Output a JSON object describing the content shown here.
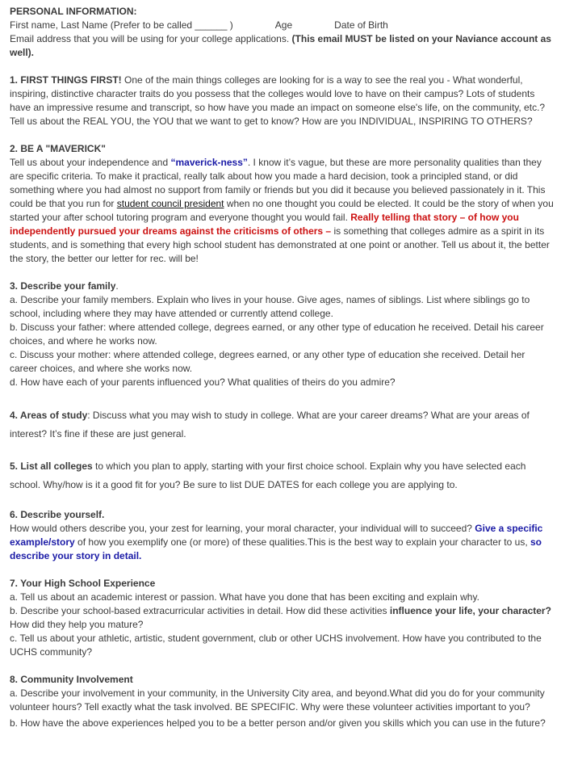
{
  "personal": {
    "heading": "PERSONAL INFORMATION:",
    "name_fields": "First name,  Last Name (Prefer to be called ______ )",
    "age": "Age",
    "dob": "Date of Birth",
    "email_text": "Email address that you will be using for your college applications.  ",
    "email_bold": "(This email MUST be listed on your Naviance account as well)."
  },
  "s1": {
    "heading": "1.  FIRST THINGS FIRST!",
    "body": " One of the main things colleges are looking for is a way to see the real you - What wonderful, inspiring, distinctive character traits do you possess that the colleges would love to have on their campus?  Lots of students have an impressive resume and transcript, so how have you made an impact on someone else's life, on the community, etc.?  Tell us about the REAL YOU, the YOU that we want to get to know?  How are you INDIVIDUAL, INSPIRING TO OTHERS?"
  },
  "s2": {
    "heading": "2.  BE A \"MAVERICK\"",
    "p1": "Tell us about your independence and ",
    "maverick": "“maverick-ness”",
    "p2": ". I know it’s vague, but these are more personality qualities than they are specific criteria. To make it practical, really talk about how you made a hard decision, took a principled stand, or did something where you had almost no support from family or friends but you did it because you believed passionately in it. This could be that you run for ",
    "council": "student council president",
    "p3": " when no one thought you could be elected. It could be the story of when you started your after school tutoring program and everyone thought you would fail. ",
    "red": "Really telling that story – of how you independently pursued your dreams against the criticisms of others –",
    "p4": " is something that colleges admire as a spirit in its students, and is something that every high school student has demonstrated at one point or another. Tell us about it, the better the story, the better our letter for rec. will be!"
  },
  "s3": {
    "heading": "3. Describe your family",
    "heading_end": ".",
    "a": "a. Describe your family members. Explain who lives in your house. Give ages, names of siblings. List where siblings go to school, including where they may have attended or currently attend college.",
    "b": "b. Discuss your father: where attended college, degrees earned, or any other type of education he received.  Detail his career choices, and where he works now.",
    "c": "c. Discuss your mother: where attended college, degrees earned, or any other type of education she received.  Detail her career choices, and where she works now.",
    "d": "d. How have each of your parents influenced you? What qualities of theirs do you admire?"
  },
  "s4": {
    "heading": " 4. Areas of study",
    "body": ": Discuss what you may wish to study in college. What are your career dreams? What are your areas of interest? It’s fine if these are just general."
  },
  "s5": {
    "heading": " 5. List all colleges",
    "body": " to which you plan to apply, starting with your first choice school. Explain why you have selected each school. Why/how is it a good fit for you?  Be sure to list DUE DATES for each college you are applying to."
  },
  "s6": {
    "heading": "6. Describe yourself.",
    "body": "How would others describe you, your zest for learning, your moral character, your individual will to succeed?   ",
    "blue1": "Give a specific example/story",
    "body2": " of how you exemplify one (or more) of these qualities.This is the best way to explain your character to us, ",
    "blue2": "so describe your story in detail."
  },
  "s7": {
    "heading": "7.  Your High School Experience",
    "a": "a. Tell us about an academic interest or passion. What have you done that has been exciting and explain why.",
    "b1": "b.  Describe your school-based extracurricular activities in detail.  How did these activities ",
    "b_bold": "influence your life, your character?",
    "b2": " How did they help you mature?",
    "c": "c. Tell us about your athletic, artistic, student government, club or other UCHS involvement. How have you contributed to the UCHS community?"
  },
  "s8": {
    "heading": "8.  Community Involvement",
    "a": "a.   Describe your involvement in your community, in the University City area, and beyond.What did you do for your  community volunteer hours? Tell exactly what the  task involved. BE SPECIFIC.  Why were these volunteer activities important to you?",
    "b": "b. How have the above experiences helped you to be a better person and/or given you skills which you can use in the future?"
  }
}
